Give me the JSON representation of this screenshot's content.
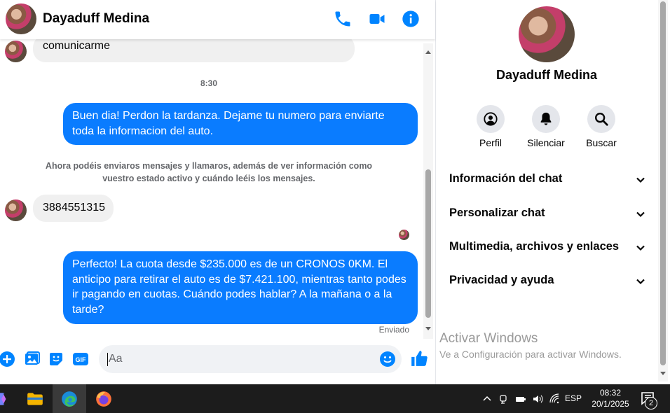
{
  "colors": {
    "accent": "#0084ff",
    "bubble_out": "#0a7cff",
    "bubble_in": "#f0f0f0",
    "muted": "#65676b"
  },
  "header": {
    "contact_name": "Dayaduff Medina",
    "icons": [
      "phone-icon",
      "video-icon",
      "info-icon"
    ]
  },
  "messages": {
    "partial_incoming": "comunicarme",
    "time_separator": "8:30",
    "outgoing_1": "Buen dia! Perdon la tardanza. Dejame tu numero para enviarte toda la informacion del auto.",
    "notice": "Ahora podéis enviaros mensajes y llamaros, además de ver información como vuestro estado activo y cuándo leéis los mensajes.",
    "incoming_1": "3884551315",
    "outgoing_2": "Perfecto! La cuota desde $235.000 es de un CRONOS 0KM. El anticipo para retirar el auto es de $7.421.100, mientras tanto podes ir pagando en cuotas. Cuándo podes hablar? A la mañana o a la tarde?",
    "status": "Enviado"
  },
  "composer": {
    "placeholder": "Aa",
    "icons": [
      "plus-icon",
      "photo-icon",
      "sticker-icon",
      "gif-icon",
      "emoji-icon",
      "like-icon"
    ],
    "gif_label": "GIF"
  },
  "info_panel": {
    "name": "Dayaduff Medina",
    "actions": [
      {
        "label": "Perfil",
        "icon": "profile-icon"
      },
      {
        "label": "Silenciar",
        "icon": "bell-icon"
      },
      {
        "label": "Buscar",
        "icon": "search-icon"
      }
    ],
    "sections": [
      "Información del chat",
      "Personalizar chat",
      "Multimedia, archivos y enlaces",
      "Privacidad y ayuda"
    ]
  },
  "watermark": {
    "title": "Activar Windows",
    "subtitle": "Ve a Configuración para activar Windows."
  },
  "taskbar": {
    "apps": [
      "copilot-icon",
      "file-explorer-icon",
      "edge-icon",
      "firefox-icon"
    ],
    "language": "ESP",
    "time": "08:32",
    "date": "20/1/2025",
    "notification_count": "2"
  }
}
